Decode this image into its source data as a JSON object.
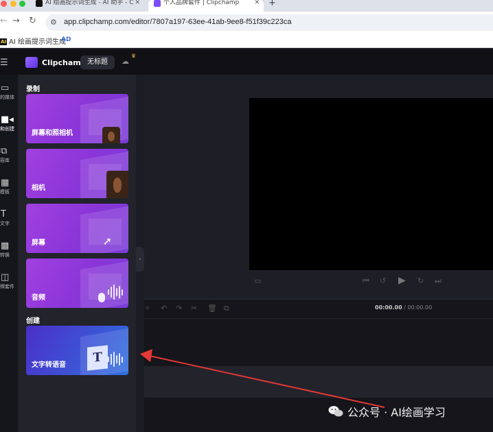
{
  "browser": {
    "tabs": [
      {
        "label": "AI 绘画提示词生成 - AI 助手 - C"
      },
      {
        "label": "个人品牌套件 | Clipchamp"
      }
    ],
    "address": {
      "url": "app.clipchamp.com/editor/7807a197-63ee-41ab-9ee8-f51f39c223ca"
    },
    "bookmarks": [
      {
        "badge": "AI",
        "label": "AI 绘画提示词生成"
      },
      {
        "badge": "",
        "label": "AD"
      }
    ]
  },
  "app": {
    "name": "Clipchamp",
    "project_title": "无标题",
    "rail": [
      {
        "label": "的媒体",
        "icon": "folder-icon"
      },
      {
        "label": "和创建",
        "icon": "video-camera-icon"
      },
      {
        "label": "容库",
        "icon": "content-library-icon"
      },
      {
        "label": "模板",
        "icon": "templates-icon"
      },
      {
        "label": "文字",
        "icon": "text-icon"
      },
      {
        "label": "转换",
        "icon": "transitions-icon"
      },
      {
        "label": "牌套件",
        "icon": "brand-kit-icon"
      }
    ],
    "panel": {
      "section_record": "录制",
      "cards_record": [
        {
          "label": "屏幕和照相机"
        },
        {
          "label": "相机"
        },
        {
          "label": "屏幕"
        },
        {
          "label": "音频"
        }
      ],
      "section_create": "创建",
      "cards_create": [
        {
          "label": "文字转语音",
          "glyph": "T"
        }
      ]
    },
    "timeline": {
      "current": "00:00.00",
      "separator": " / ",
      "total": "00:00.00"
    }
  },
  "watermark": {
    "text": "公众号 · AI绘画学习"
  },
  "colors": {
    "accent": "#8a35d8",
    "arrow": "#e53935"
  }
}
